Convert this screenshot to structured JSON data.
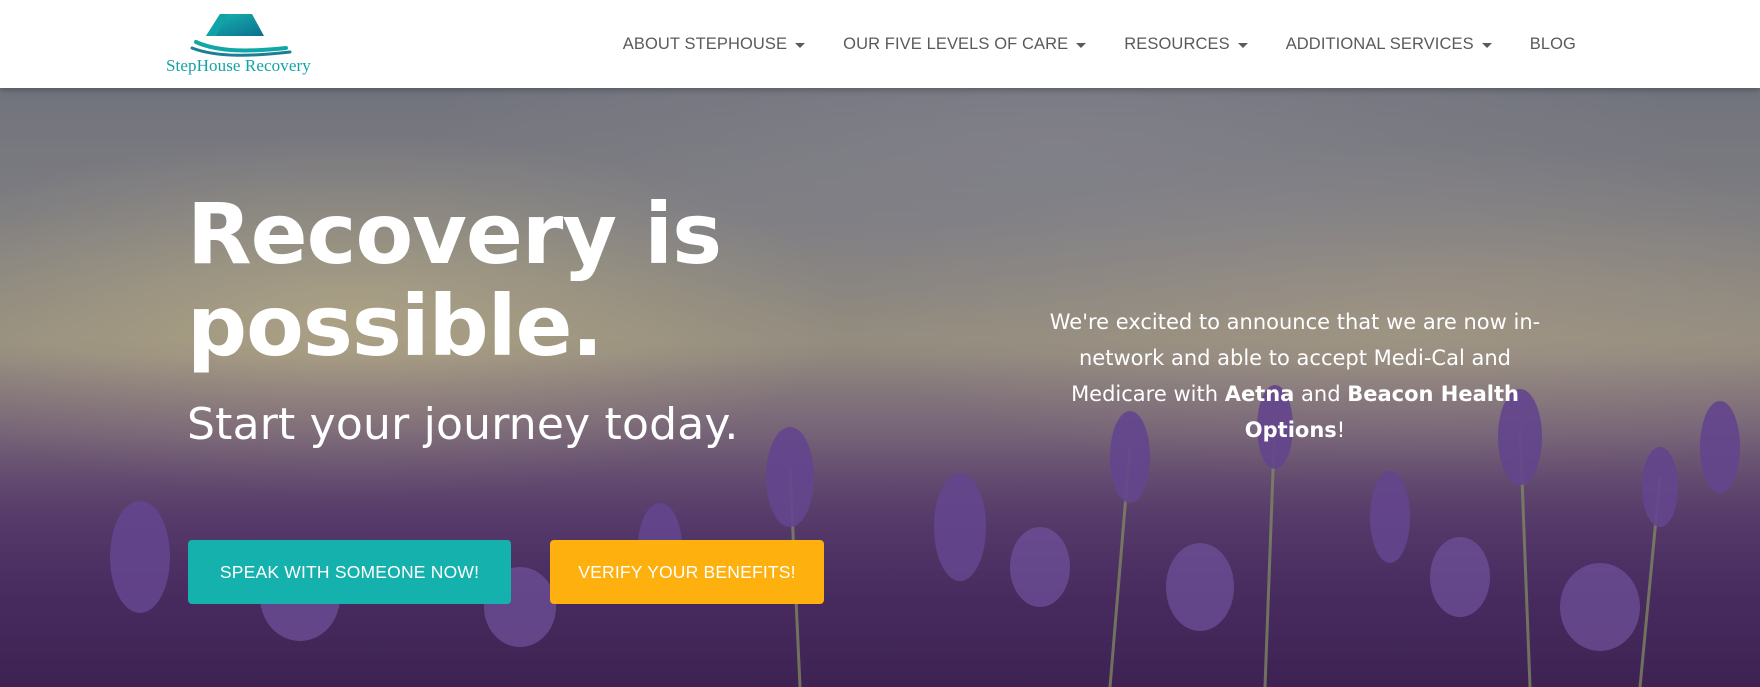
{
  "colors": {
    "brand_teal": "#13a3a6",
    "button_teal": "#15b1ad",
    "button_yellow": "#fdb00e",
    "nav_text": "#5a5a5a",
    "hero_text": "#ffffff"
  },
  "header": {
    "logo": {
      "text": "StepHouse Recovery",
      "icon": "house-logo-icon"
    },
    "nav": [
      {
        "label": "ABOUT STEPHOUSE",
        "has_dropdown": true
      },
      {
        "label": "OUR FIVE LEVELS OF CARE",
        "has_dropdown": true
      },
      {
        "label": "RESOURCES",
        "has_dropdown": true
      },
      {
        "label": "ADDITIONAL SERVICES",
        "has_dropdown": true
      },
      {
        "label": "BLOG",
        "has_dropdown": false
      }
    ]
  },
  "hero": {
    "headline_line1": "Recovery is",
    "headline_line2": "possible.",
    "subheadline": "Start your journey today.",
    "announcement": {
      "part1": "We're excited to announce that we are now in-network and able to accept Medi-Cal and Medicare with ",
      "bold1": "Aetna",
      "part2": " and ",
      "bold2": "Beacon Health Options",
      "part3": "!"
    },
    "buttons": {
      "speak": "SPEAK WITH SOMEONE NOW!",
      "verify": "VERIFY YOUR BENEFITS!"
    },
    "background": "lavender-field-image"
  }
}
